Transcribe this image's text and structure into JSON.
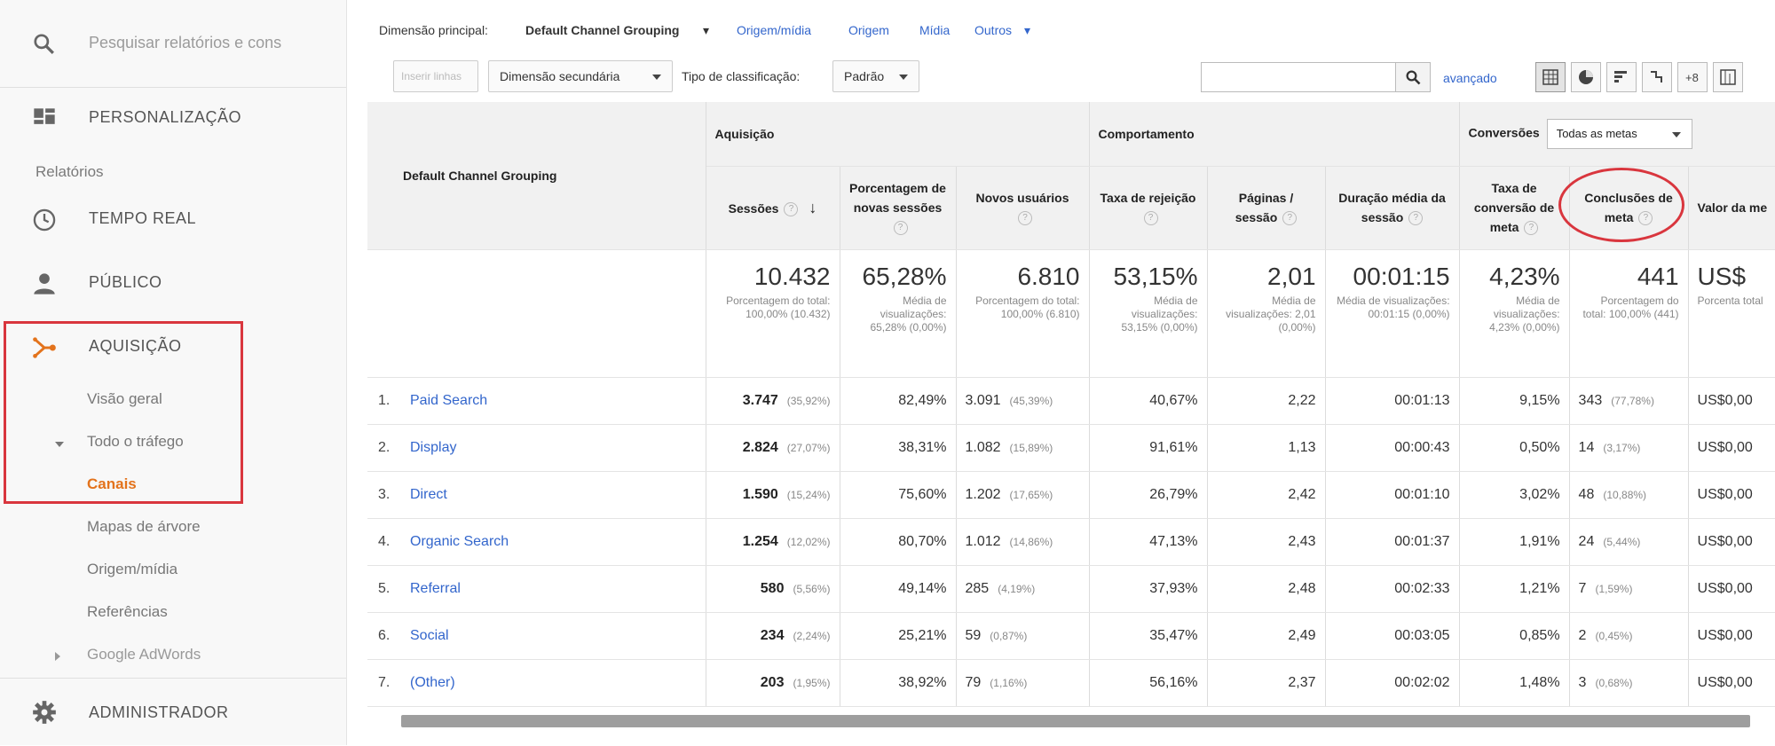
{
  "sidebar": {
    "search_placeholder": "Pesquisar relatórios e cons",
    "personalizacao": "PERSONALIZAÇÃO",
    "relatorios": "Relatórios",
    "tempo_real": "TEMPO REAL",
    "publico": "PÚBLICO",
    "aquisicao": "AQUISIÇÃO",
    "visao_geral": "Visão geral",
    "todo_trafego": "Todo o tráfego",
    "canais": "Canais",
    "mapas": "Mapas de árvore",
    "origem_midia": "Origem/mídia",
    "referencias": "Referências",
    "adwords": "Google AdWords",
    "admin": "ADMINISTRADOR",
    "accent_color": "#e3731c"
  },
  "toolbar": {
    "dim_label": "Dimensão principal:",
    "dim_value": "Default Channel Grouping",
    "link_origem_midia": "Origem/mídia",
    "link_origem": "Origem",
    "link_midia": "Mídia",
    "link_outros": "Outros",
    "inserir_linhas": "Inserir linhas",
    "dim_secundaria": "Dimensão secundária",
    "tipo_label": "Tipo de classificação:",
    "tipo_value": "Padrão",
    "avancado": "avançado"
  },
  "table": {
    "header_channel": "Default Channel Grouping",
    "group_aquisicao": "Aquisição",
    "group_comportamento": "Comportamento",
    "group_conversoes": "Conversões",
    "conversoes_select": "Todas as metas",
    "columns": [
      "Sessões",
      "Porcentagem de novas sessões",
      "Novos usuários",
      "Taxa de rejeição",
      "Páginas / sessão",
      "Duração média da sessão",
      "Taxa de conversão de meta",
      "Conclusões de meta",
      "Valor da me"
    ],
    "totals": [
      {
        "big": "10.432",
        "sub": "Porcentagem do total: 100,00% (10.432)"
      },
      {
        "big": "65,28%",
        "sub": "Média de visualizações: 65,28% (0,00%)"
      },
      {
        "big": "6.810",
        "sub": "Porcentagem do total: 100,00% (6.810)"
      },
      {
        "big": "53,15%",
        "sub": "Média de visualizações: 53,15% (0,00%)"
      },
      {
        "big": "2,01",
        "sub": "Média de visualizações: 2,01 (0,00%)"
      },
      {
        "big": "00:01:15",
        "sub": "Média de visualizações: 00:01:15 (0,00%)"
      },
      {
        "big": "4,23%",
        "sub": "Média de visualizações: 4,23% (0,00%)"
      },
      {
        "big": "441",
        "sub": "Porcentagem do total: 100,00% (441)"
      },
      {
        "big": "US$",
        "sub": "Porcenta total"
      }
    ],
    "rows": [
      {
        "idx": "1.",
        "channel": "Paid Search",
        "sessions": "3.747",
        "sessions_pct": "(35,92%)",
        "new_pct": "82,49%",
        "new_users": "3.091",
        "new_users_pct": "(45,39%)",
        "bounce": "40,67%",
        "pages": "2,22",
        "duration": "00:01:13",
        "conv": "9,15%",
        "goals": "343",
        "goals_pct": "(77,78%)",
        "value": "US$0,00"
      },
      {
        "idx": "2.",
        "channel": "Display",
        "sessions": "2.824",
        "sessions_pct": "(27,07%)",
        "new_pct": "38,31%",
        "new_users": "1.082",
        "new_users_pct": "(15,89%)",
        "bounce": "91,61%",
        "pages": "1,13",
        "duration": "00:00:43",
        "conv": "0,50%",
        "goals": "14",
        "goals_pct": "(3,17%)",
        "value": "US$0,00"
      },
      {
        "idx": "3.",
        "channel": "Direct",
        "sessions": "1.590",
        "sessions_pct": "(15,24%)",
        "new_pct": "75,60%",
        "new_users": "1.202",
        "new_users_pct": "(17,65%)",
        "bounce": "26,79%",
        "pages": "2,42",
        "duration": "00:01:10",
        "conv": "3,02%",
        "goals": "48",
        "goals_pct": "(10,88%)",
        "value": "US$0,00"
      },
      {
        "idx": "4.",
        "channel": "Organic Search",
        "sessions": "1.254",
        "sessions_pct": "(12,02%)",
        "new_pct": "80,70%",
        "new_users": "1.012",
        "new_users_pct": "(14,86%)",
        "bounce": "47,13%",
        "pages": "2,43",
        "duration": "00:01:37",
        "conv": "1,91%",
        "goals": "24",
        "goals_pct": "(5,44%)",
        "value": "US$0,00"
      },
      {
        "idx": "5.",
        "channel": "Referral",
        "sessions": "580",
        "sessions_pct": "(5,56%)",
        "new_pct": "49,14%",
        "new_users": "285",
        "new_users_pct": "(4,19%)",
        "bounce": "37,93%",
        "pages": "2,48",
        "duration": "00:02:33",
        "conv": "1,21%",
        "goals": "7",
        "goals_pct": "(1,59%)",
        "value": "US$0,00"
      },
      {
        "idx": "6.",
        "channel": "Social",
        "sessions": "234",
        "sessions_pct": "(2,24%)",
        "new_pct": "25,21%",
        "new_users": "59",
        "new_users_pct": "(0,87%)",
        "bounce": "35,47%",
        "pages": "2,49",
        "duration": "00:03:05",
        "conv": "0,85%",
        "goals": "2",
        "goals_pct": "(0,45%)",
        "value": "US$0,00"
      },
      {
        "idx": "7.",
        "channel": "(Other)",
        "sessions": "203",
        "sessions_pct": "(1,95%)",
        "new_pct": "38,92%",
        "new_users": "79",
        "new_users_pct": "(1,16%)",
        "bounce": "56,16%",
        "pages": "2,37",
        "duration": "00:02:02",
        "conv": "1,48%",
        "goals": "3",
        "goals_pct": "(0,68%)",
        "value": "US$0,00"
      }
    ]
  }
}
